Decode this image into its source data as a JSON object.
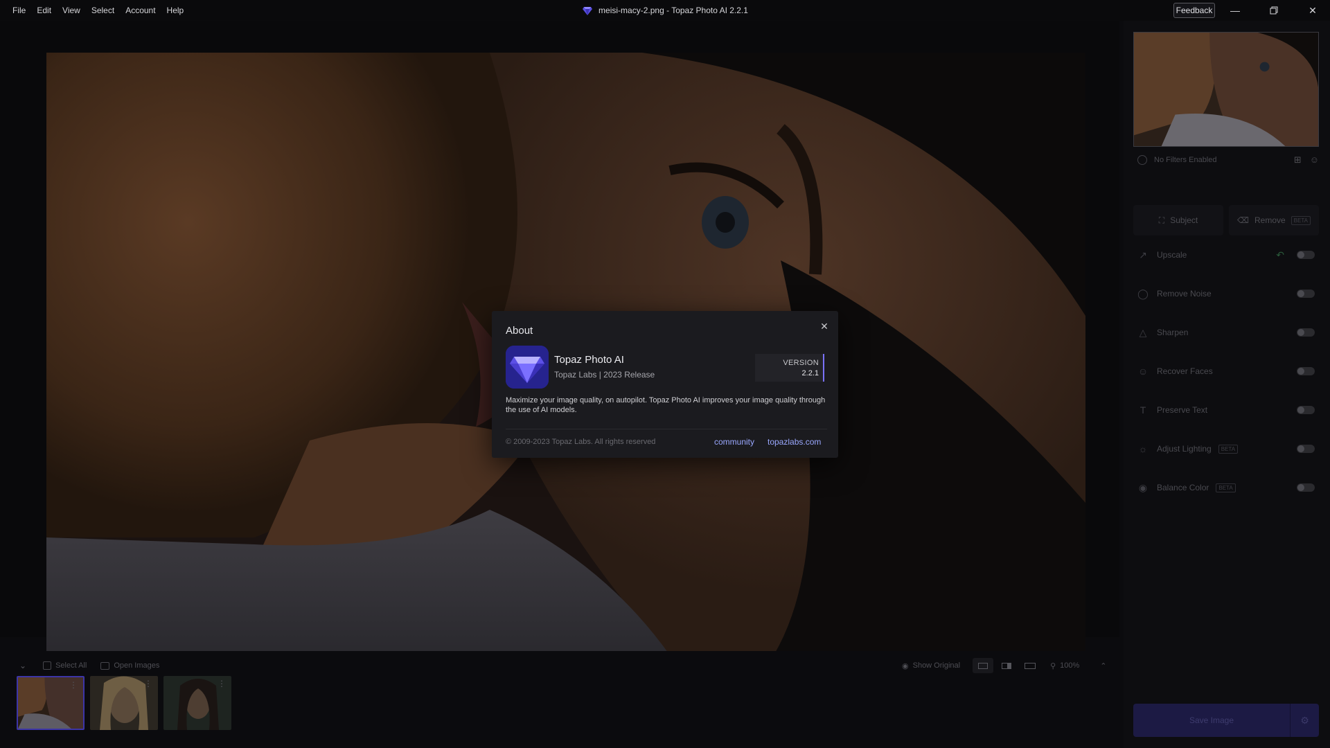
{
  "titlebar": {
    "menu": [
      "File",
      "Edit",
      "View",
      "Select",
      "Account",
      "Help"
    ],
    "window_title": "meisi-macy-2.png - Topaz Photo AI 2.2.1",
    "feedback_label": "Feedback"
  },
  "right_panel": {
    "filters_status": "No Filters Enabled",
    "subject_label": "Subject",
    "remove_label": "Remove",
    "beta_label": "BETA",
    "filters": [
      {
        "label": "Upscale",
        "icon": "upscale-icon"
      },
      {
        "label": "Remove Noise",
        "icon": "noise-icon"
      },
      {
        "label": "Sharpen",
        "icon": "sharpen-icon"
      },
      {
        "label": "Recover Faces",
        "icon": "face-icon"
      },
      {
        "label": "Preserve Text",
        "icon": "text-icon"
      },
      {
        "label": "Adjust Lighting",
        "icon": "sun-icon",
        "beta": "BETA"
      },
      {
        "label": "Balance Color",
        "icon": "palette-icon",
        "beta": "BETA"
      }
    ],
    "save_label": "Save Image"
  },
  "bottom_bar": {
    "select_all": "Select All",
    "open_images": "Open Images",
    "show_original": "Show Original",
    "zoom": "100%"
  },
  "about_dialog": {
    "title": "About",
    "app_name": "Topaz Photo AI",
    "subtitle": "Topaz Labs | 2023 Release",
    "version_label": "VERSION",
    "version_value": "2.2.1",
    "description": "Maximize your image quality, on autopilot. Topaz Photo AI improves your image quality through the use of AI models.",
    "copyright": "© 2009-2023 Topaz Labs. All rights reserved",
    "link_community": "community",
    "link_site": "topazlabs.com"
  },
  "colors": {
    "accent": "#3d35a8",
    "link": "#9aa8ff",
    "version_bar": "#7a72ff"
  }
}
